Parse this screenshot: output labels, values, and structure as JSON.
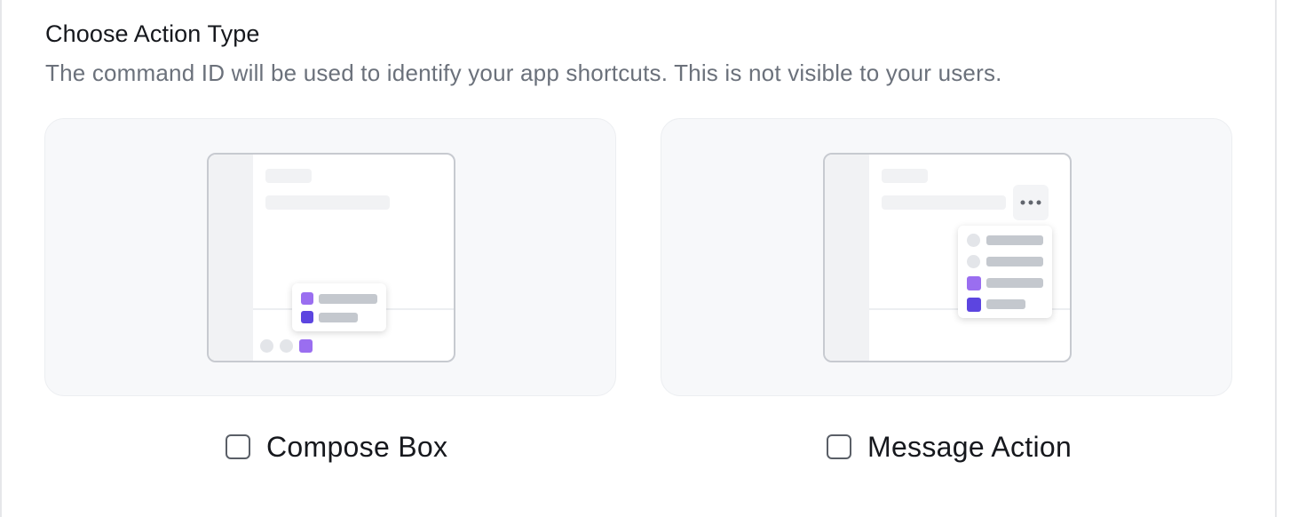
{
  "section": {
    "title": "Choose Action Type",
    "subtitle": "The command ID will be used to identify your app shortcuts. This is not visible to your users."
  },
  "options": [
    {
      "id": "compose_box",
      "label": "Compose Box",
      "checked": false,
      "illustration": "compose-box-illustration"
    },
    {
      "id": "message_action",
      "label": "Message Action",
      "checked": false,
      "illustration": "message-action-illustration"
    }
  ],
  "icons": {
    "more_menu": "more-horizontal-icon"
  },
  "colors": {
    "card_background": "#f7f8fa",
    "accent_light": "#9a6ef0",
    "accent_dark": "#5c45e0",
    "title_text": "#16181d",
    "muted_text": "#6b717b"
  }
}
